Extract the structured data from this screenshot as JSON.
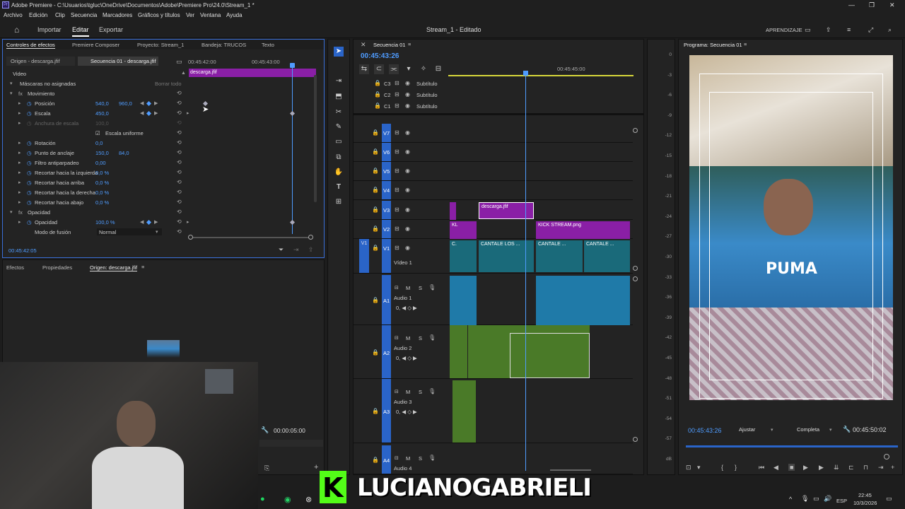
{
  "window": {
    "title": "Adobe Premiere - C:\\Usuarios\\tgluc\\OneDrive\\Documentos\\Adobe\\Premiere Pro\\24.0\\Stream_1 *",
    "app_logo": "Pr"
  },
  "menu": [
    "Archivo",
    "Edición",
    "Clip",
    "Secuencia",
    "Marcadores",
    "Gráficos y títulos",
    "Ver",
    "Ventana",
    "Ayuda"
  ],
  "workspace": {
    "tabs": [
      "Importar",
      "Editar",
      "Exportar"
    ],
    "active": "Editar",
    "center_title": "Stream_1 - Editado",
    "right_label": "APRENDIZAJE"
  },
  "effect_controls": {
    "tabs": [
      "Controles de efectos",
      "Premiere Composer",
      "Proyecto: Stream_1",
      "Bandeja: TRUCOS",
      "Texto"
    ],
    "source_tab": "Origen - descarga.jfif",
    "sequence_tab": "Secuencia 01 - descarga.jfif",
    "time_start": "00:45:42:00",
    "time_mid": "00:45:43:00",
    "clip_label": "descarga.jfif",
    "section_video": "Video",
    "masks_label": "Máscaras no asignadas",
    "clear_all": "Borrar todo",
    "motion": "Movimiento",
    "rows": [
      {
        "label": "Posición",
        "v1": "540,0",
        "v2": "960,0"
      },
      {
        "label": "Escala",
        "v1": "450,0",
        "v2": ""
      },
      {
        "label": "Anchura de escala",
        "v1": "100,0",
        "v2": ""
      },
      {
        "label": "Escala uniforme",
        "v1": "",
        "v2": ""
      },
      {
        "label": "Rotación",
        "v1": "0,0",
        "v2": ""
      },
      {
        "label": "Punto de anclaje",
        "v1": "150,0",
        "v2": "84,0"
      },
      {
        "label": "Filtro antiparpadeo",
        "v1": "0,00",
        "v2": ""
      },
      {
        "label": "Recortar hacia la izquierda",
        "v1": "0,0 %",
        "v2": ""
      },
      {
        "label": "Recortar hacia arriba",
        "v1": "0,0 %",
        "v2": ""
      },
      {
        "label": "Recortar hacia la derecha",
        "v1": "0,0 %",
        "v2": ""
      },
      {
        "label": "Recortar hacia abajo",
        "v1": "0,0 %",
        "v2": ""
      }
    ],
    "opacity_section": "Opacidad",
    "opacity_label": "Opacidad",
    "opacity_value": "100,0 %",
    "blend_label": "Modo de fusión",
    "blend_value": "Normal",
    "timecode": "00:45:42:05"
  },
  "lower_left": {
    "tabs": [
      "Efectos",
      "Propiedades",
      "Origen: descarga.jfif"
    ],
    "timecode": "00:00:05:00"
  },
  "timeline": {
    "tab": "Secuencia 01",
    "timecode": "00:45:43:26",
    "ruler_label": "00:45:45:00",
    "subtitle_tracks": [
      {
        "id": "C3",
        "label": "Subtítulo"
      },
      {
        "id": "C2",
        "label": "Subtítulo"
      },
      {
        "id": "C1",
        "label": "Subtítulo"
      }
    ],
    "video_tracks": [
      "V7",
      "V6",
      "V5",
      "V4",
      "V3",
      "V2",
      "V1"
    ],
    "video1_name": "Vídeo 1",
    "audio_tracks": [
      {
        "id": "A1",
        "name": "Audio 1"
      },
      {
        "id": "A2",
        "name": "Audio 2"
      },
      {
        "id": "A3",
        "name": "Audio 3"
      },
      {
        "id": "A4",
        "name": "Audio 4"
      }
    ],
    "clips": {
      "v3": "descarga.jfif",
      "v2_left": "KL",
      "v2_right": "KICK STREAM.png",
      "v1": [
        "C.",
        "CANTALE LOS ...",
        "CANTALE ...",
        "CANTALE ..."
      ]
    },
    "meter_ticks": [
      "0",
      "-3",
      "-6",
      "-9",
      "-12",
      "-15",
      "-18",
      "-21",
      "-24",
      "-27",
      "-30",
      "-33",
      "-36",
      "-39",
      "-42",
      "-45",
      "-48",
      "-51",
      "-54",
      "-57",
      "dB"
    ]
  },
  "program": {
    "tab": "Programa: Secuencia 01",
    "timecode": "00:45:43:26",
    "fit": "Ajustar",
    "quality": "Completa",
    "duration": "00:45:50:02",
    "shirt_text": "PUMA"
  },
  "overlay": {
    "streamer_name": "LUCIANOGABRIELI",
    "logo_letter": "K"
  },
  "taskbar": {
    "lang": "ESP",
    "time": "22:45",
    "date": "10/3/2026"
  }
}
